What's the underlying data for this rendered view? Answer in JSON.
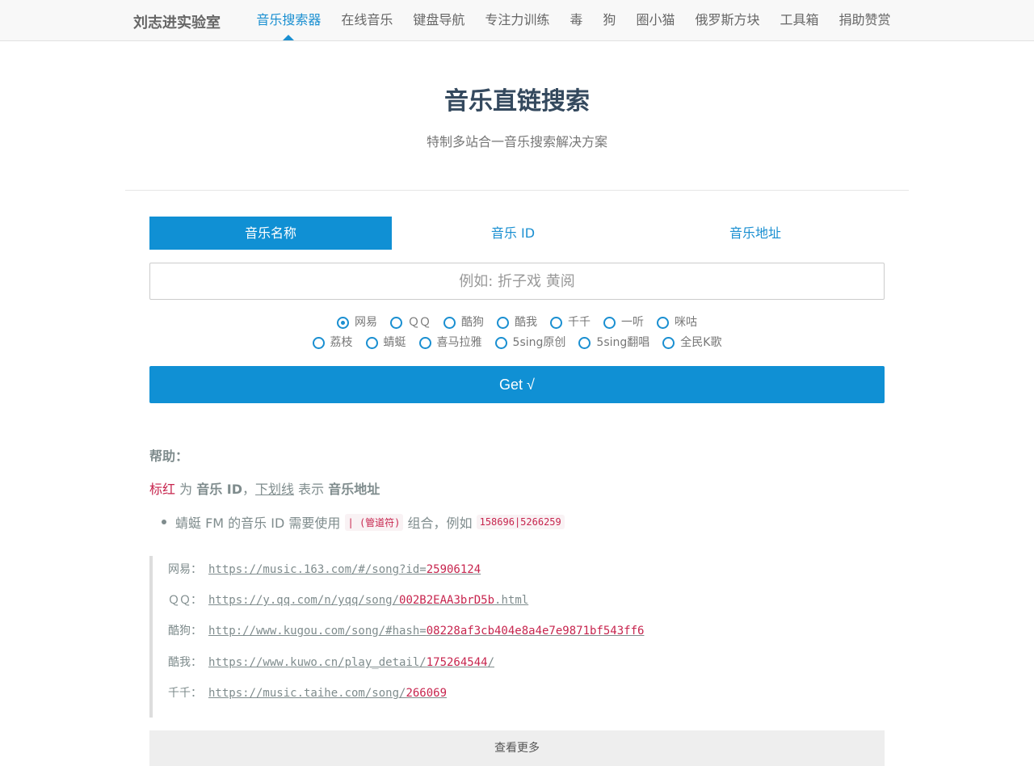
{
  "nav": {
    "brand": "刘志进实验室",
    "links": [
      {
        "label": "音乐搜索器",
        "active": true
      },
      {
        "label": "在线音乐"
      },
      {
        "label": "键盘导航"
      },
      {
        "label": "专注力训练"
      },
      {
        "label": "毒"
      },
      {
        "label": "狗"
      },
      {
        "label": "圈小猫"
      },
      {
        "label": "俄罗斯方块"
      },
      {
        "label": "工具箱"
      },
      {
        "label": "捐助赞赏"
      }
    ]
  },
  "hero": {
    "title": "音乐直链搜索",
    "subtitle": "特制多站合一音乐搜索解决方案"
  },
  "tabs": [
    {
      "label": "音乐名称",
      "active": true
    },
    {
      "label": "音乐 ID"
    },
    {
      "label": "音乐地址"
    }
  ],
  "search": {
    "placeholder": "例如: 折子戏 黄阅",
    "value": ""
  },
  "sources_row1": [
    {
      "label": "网易",
      "checked": true
    },
    {
      "label": "ＱＱ"
    },
    {
      "label": "酷狗"
    },
    {
      "label": "酷我"
    },
    {
      "label": "千千"
    },
    {
      "label": "一听"
    },
    {
      "label": "咪咕"
    }
  ],
  "sources_row2": [
    {
      "label": "荔枝"
    },
    {
      "label": "蜻蜓"
    },
    {
      "label": "喜马拉雅"
    },
    {
      "label": "5sing原创"
    },
    {
      "label": "5sing翻唱"
    },
    {
      "label": "全民K歌"
    }
  ],
  "get_button": "Get √",
  "help": {
    "title": "帮助：",
    "legend_red": "标红",
    "legend_for": " 为 ",
    "legend_id": "音乐 ID",
    "legend_comma": "，",
    "legend_underline": "下划线",
    "legend_means": " 表示 ",
    "legend_url": "音乐地址",
    "bullet_pre": "蜻蜓 FM 的音乐 ID 需要使用",
    "bullet_code1": "| (管道符)",
    "bullet_mid": "组合，例如",
    "bullet_code2": "158696|5266259"
  },
  "examples": [
    {
      "label": "网易：",
      "pre": "https://music.163.com/#/song?id=",
      "hl": "25906124",
      "post": ""
    },
    {
      "label": "ＱＱ：",
      "pre": "https://y.qq.com/n/yqq/song/",
      "hl": "002B2EAA3brD5b",
      "post": ".html"
    },
    {
      "label": "酷狗：",
      "pre": "http://www.kugou.com/song/#hash=",
      "hl": "08228af3cb404e8a4e7e9871bf543ff6",
      "post": ""
    },
    {
      "label": "酷我：",
      "pre": "https://www.kuwo.cn/play_detail/",
      "hl": "175264544",
      "post": "/"
    },
    {
      "label": "千千：",
      "pre": "https://music.taihe.com/song/",
      "hl": "266069",
      "post": ""
    }
  ],
  "more_button": "查看更多",
  "colors": {
    "accent": "#1090d4",
    "highlight": "#c7254e"
  }
}
